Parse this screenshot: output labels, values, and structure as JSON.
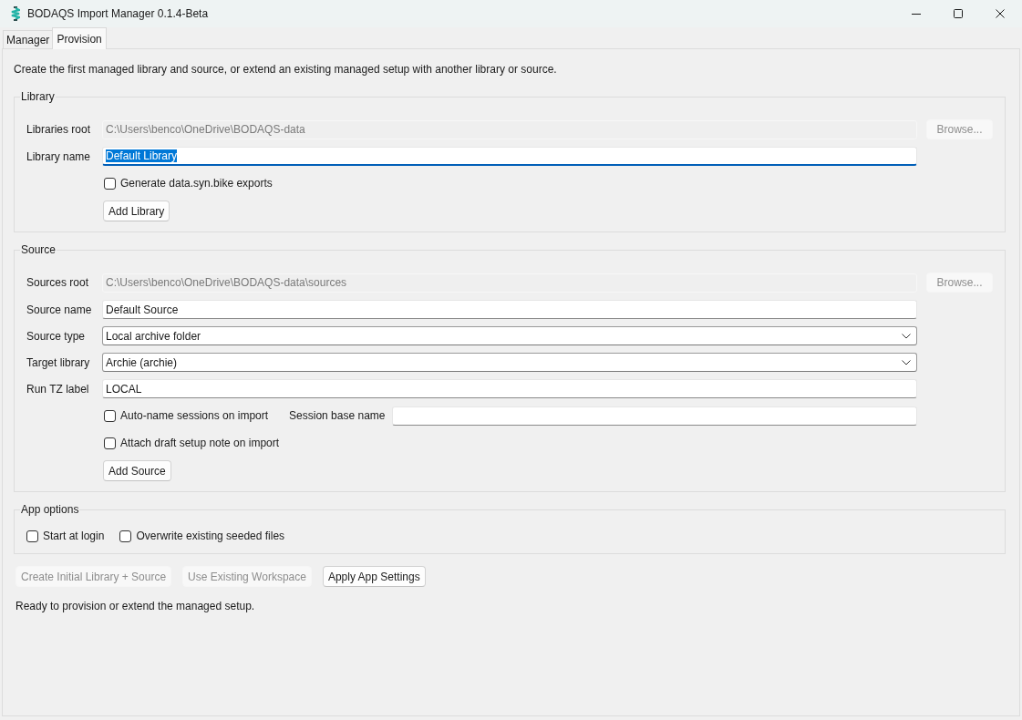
{
  "window": {
    "title": "BODAQS Import Manager 0.1.4-Beta"
  },
  "tabs": [
    {
      "label": "Manager",
      "selected": false
    },
    {
      "label": "Provision",
      "selected": true
    }
  ],
  "intro": "Create the first managed library and source, or extend an existing managed setup with another library or source.",
  "groups": [
    {
      "title": "Library",
      "rows": [
        {
          "kind": "path",
          "label": "Libraries root",
          "value": "C:\\Users\\benco\\OneDrive\\BODAQS-data",
          "disabled": true,
          "browse": {
            "label": "Browse...",
            "disabled": true
          }
        },
        {
          "kind": "text",
          "label": "Library name",
          "value": "Default Library",
          "focused": true
        },
        {
          "kind": "checkbox",
          "label": "Generate data.syn.bike exports",
          "checked": false
        },
        {
          "kind": "button",
          "label": "Add Library",
          "disabled": false
        }
      ]
    },
    {
      "title": "Source",
      "rows": [
        {
          "kind": "path",
          "label": "Sources root",
          "value": "C:\\Users\\benco\\OneDrive\\BODAQS-data\\sources",
          "disabled": true,
          "browse": {
            "label": "Browse...",
            "disabled": true
          }
        },
        {
          "kind": "text",
          "label": "Source name",
          "value": "Default Source",
          "focused": false
        },
        {
          "kind": "select",
          "label": "Source type",
          "value": "Local archive folder"
        },
        {
          "kind": "select",
          "label": "Target library",
          "value": "Archie (archie)"
        },
        {
          "kind": "text",
          "label": "Run TZ label",
          "value": "LOCAL",
          "focused": false
        },
        {
          "kind": "checkbox_field",
          "label": "Auto-name sessions on import",
          "checked": false,
          "field_label": "Session base name"
        },
        {
          "kind": "checkbox",
          "label": "Attach draft setup note on import",
          "checked": false
        },
        {
          "kind": "button",
          "label": "Add Source",
          "disabled": false
        }
      ]
    },
    {
      "title": "App options",
      "rows": [
        {
          "kind": "checkbox_group",
          "options": [
            {
              "label": "Start at login",
              "checked": false
            },
            {
              "label": "Overwrite existing seeded files",
              "checked": false
            }
          ]
        }
      ]
    }
  ],
  "actions": [
    {
      "label": "Create Initial Library + Source",
      "disabled": true
    },
    {
      "label": "Use Existing Workspace",
      "disabled": true
    },
    {
      "label": "Apply App Settings",
      "disabled": false
    }
  ],
  "status": "Ready to provision or extend the managed setup."
}
